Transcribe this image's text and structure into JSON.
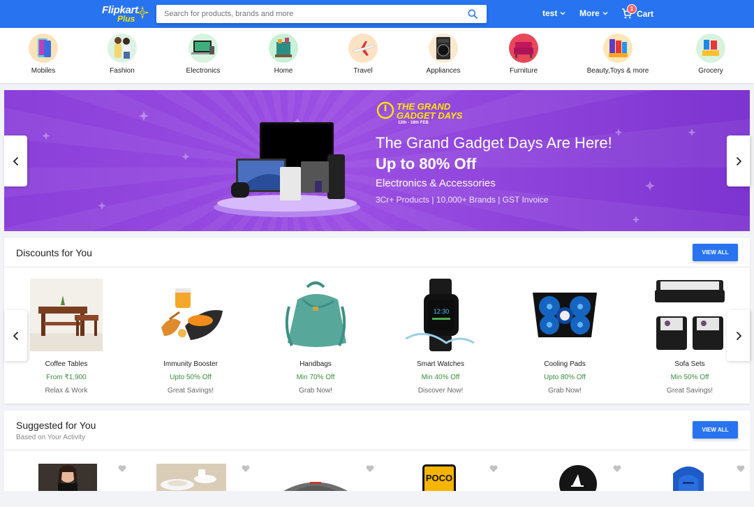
{
  "header": {
    "logo_main": "Flipkart",
    "logo_sub": "Plus",
    "search_placeholder": "Search for products, brands and more",
    "user_label": "test",
    "more_label": "More",
    "cart_label": "Cart",
    "cart_count": "1",
    "icons": [
      "search-icon",
      "chevron-down-icon",
      "cart-icon",
      "plus-star-icon"
    ],
    "brand_color": "#2874f0",
    "accent_color": "#ffe500"
  },
  "categories": [
    {
      "label": "Mobiles"
    },
    {
      "label": "Fashion"
    },
    {
      "label": "Electronics"
    },
    {
      "label": "Home"
    },
    {
      "label": "Travel"
    },
    {
      "label": "Appliances"
    },
    {
      "label": "Furniture"
    },
    {
      "label": "Beauty,Toys & more"
    },
    {
      "label": "Grocery"
    }
  ],
  "banner": {
    "badge_title": "THE GRAND GADGET DAYS",
    "badge_dates": "12th - 18th FEB",
    "headline": "The Grand Gadget Days Are Here!",
    "offer": "Up to 80% Off",
    "category": "Electronics & Accessories",
    "details": "3Cr+ Products | 10,000+ Brands | GST Invoice",
    "background_color": "#8a3fd9"
  },
  "discounts": {
    "title": "Discounts for You",
    "view_all": "VIEW ALL",
    "items": [
      {
        "name": "Coffee Tables",
        "offer": "From ₹1,900",
        "tag": "Relax & Work"
      },
      {
        "name": "Immunity Booster",
        "offer": "Upto 50% Off",
        "tag": "Great Savings!"
      },
      {
        "name": "Handbags",
        "offer": "Min 70% Off",
        "tag": "Grab Now!"
      },
      {
        "name": "Smart Watches",
        "offer": "Min 40% Off",
        "tag": "Discover Now!"
      },
      {
        "name": "Cooling Pads",
        "offer": "Upto 80% Off",
        "tag": "Grab Now!"
      },
      {
        "name": "Sofa Sets",
        "offer": "Min 50% Off",
        "tag": "Great Savings!"
      }
    ],
    "offer_color": "#388e3c"
  },
  "suggested": {
    "title": "Suggested for You",
    "subtitle": "Based on Your Activity",
    "view_all": "VIEW ALL",
    "items": [
      {
        "image_text": ""
      },
      {
        "image_text": ""
      },
      {
        "image_text": ""
      },
      {
        "image_text": "POCO"
      },
      {
        "image_text": ""
      },
      {
        "image_text": ""
      }
    ]
  }
}
